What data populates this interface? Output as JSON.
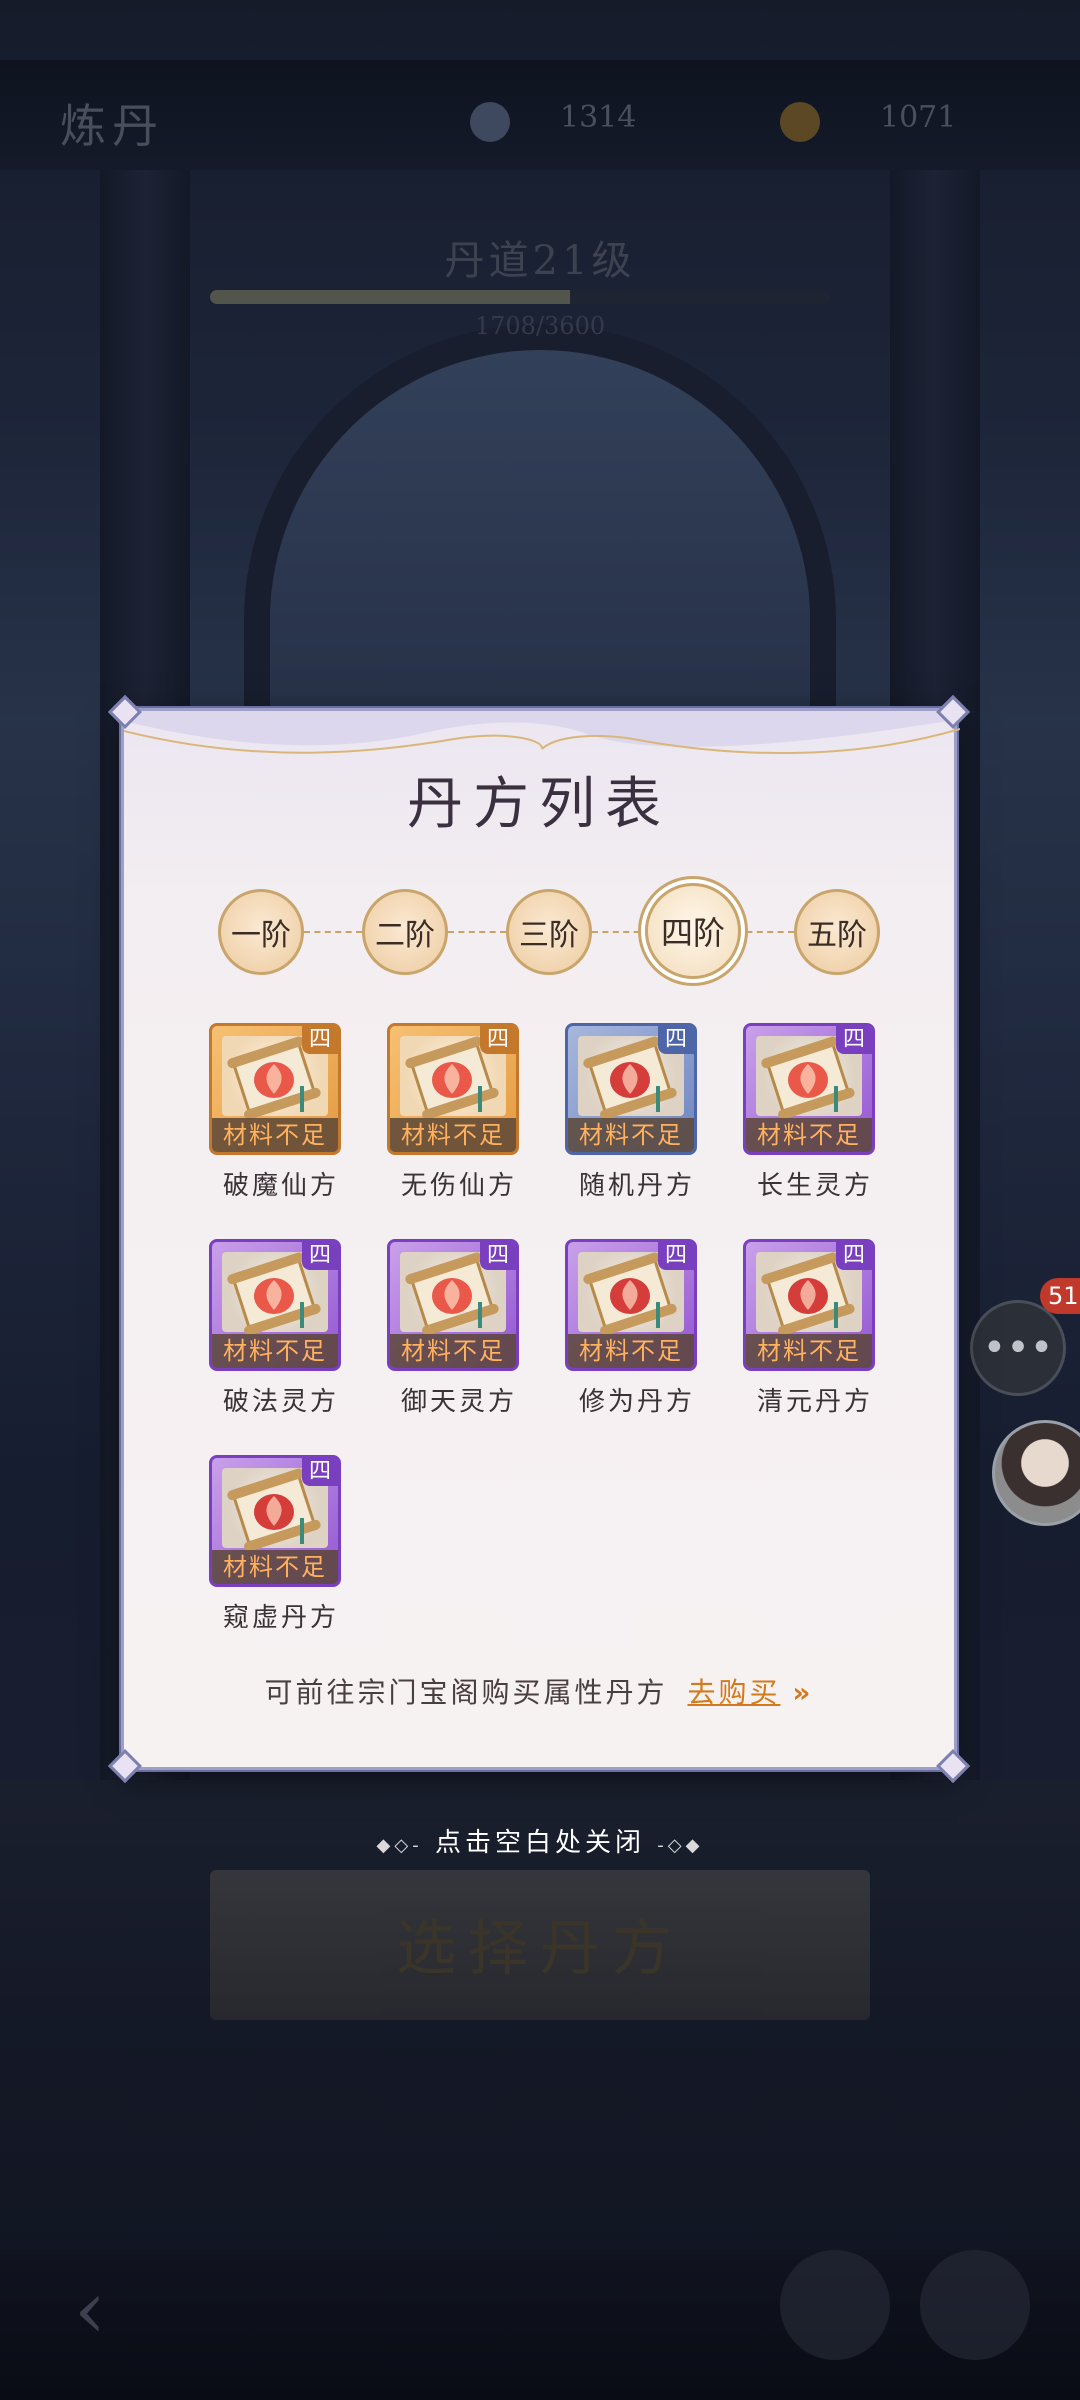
{
  "background": {
    "screen_title": "炼丹",
    "resource_1": "1314",
    "resource_2": "1071",
    "level_label": "丹道21级",
    "level_progress": 0.58,
    "level_count": "1708/3600",
    "select_board_label": "选择丹方"
  },
  "chat": {
    "badge": "51"
  },
  "modal": {
    "title": "丹方列表",
    "tiers": [
      "一阶",
      "二阶",
      "三阶",
      "四阶",
      "五阶"
    ],
    "active_tier": "四阶",
    "items": [
      {
        "name": "破魔仙方",
        "tier": "四",
        "status": "材料不足",
        "rarity": "orange",
        "flame": "#e8483a"
      },
      {
        "name": "无伤仙方",
        "tier": "四",
        "status": "材料不足",
        "rarity": "orange",
        "flame": "#e8483a"
      },
      {
        "name": "随机丹方",
        "tier": "四",
        "status": "材料不足",
        "rarity": "blue",
        "flame": "#d22a2a"
      },
      {
        "name": "长生灵方",
        "tier": "四",
        "status": "材料不足",
        "rarity": "purple",
        "flame": "#e8483a"
      },
      {
        "name": "破法灵方",
        "tier": "四",
        "status": "材料不足",
        "rarity": "purple",
        "flame": "#e8483a"
      },
      {
        "name": "御天灵方",
        "tier": "四",
        "status": "材料不足",
        "rarity": "purple",
        "flame": "#e8483a"
      },
      {
        "name": "修为丹方",
        "tier": "四",
        "status": "材料不足",
        "rarity": "purple",
        "flame": "#d22a2a"
      },
      {
        "name": "清元丹方",
        "tier": "四",
        "status": "材料不足",
        "rarity": "purple",
        "flame": "#d22a2a"
      },
      {
        "name": "窥虚丹方",
        "tier": "四",
        "status": "材料不足",
        "rarity": "purple",
        "flame": "#d22a2a"
      }
    ],
    "footer_text": "可前往宗门宝阁购买属性丹方",
    "buy_label": "去购买",
    "buy_arrow": "»"
  },
  "close_hint": "点击空白处关闭",
  "colors": {
    "accent": "#d4791c",
    "lack_text": "#ffb15e",
    "frame": "#9d9fc8"
  }
}
